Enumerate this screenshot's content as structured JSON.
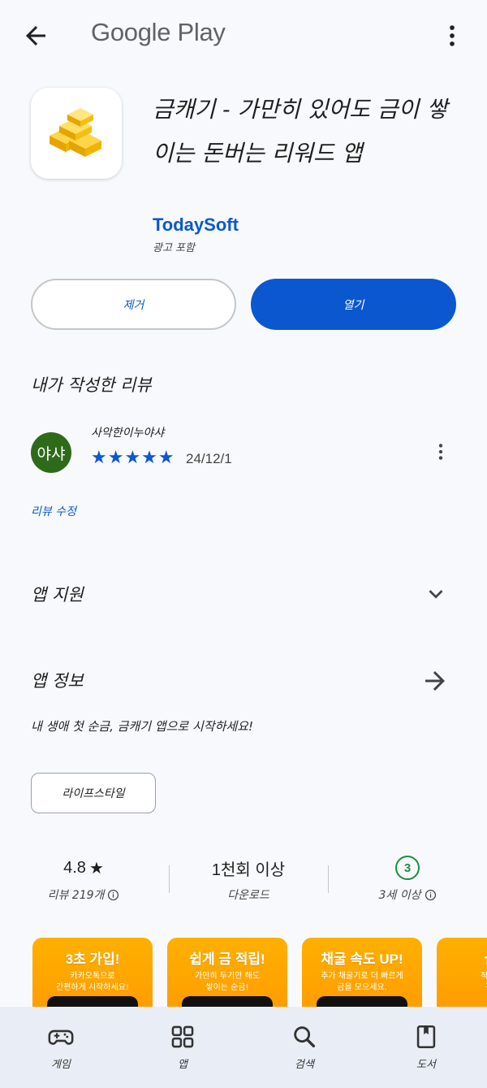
{
  "header": {
    "brand": "Google Play",
    "back_icon": "arrow-back-icon",
    "more_icon": "more-vert-icon"
  },
  "app": {
    "title": "금캐기 - 가만히 있어도 금이 쌓이는 돈버는 리워드 앱",
    "developer": "TodaySoft",
    "ads_notice": "광고 포함",
    "remove_label": "제거",
    "open_label": "열기"
  },
  "my_review": {
    "section_title": "내가 작성한 리뷰",
    "avatar_text": "야샤",
    "reviewer": "사악한이누야샤",
    "stars": "★★★★★",
    "rating": 5,
    "date": "24/12/1",
    "edit_label": "리뷰 수정"
  },
  "app_support": {
    "title": "앱 지원"
  },
  "about": {
    "title": "앱 정보",
    "description": "내 생애 첫 순금, 금캐기 앱으로 시작하세요!",
    "tag": "라이프스타일"
  },
  "stats": {
    "rating_value": "4.8",
    "rating_star": "★",
    "reviews_label": "리뷰 219개",
    "downloads_value": "1천회 이상",
    "downloads_label": "다운로드",
    "age_value": "3",
    "age_label": "3세 이상"
  },
  "screenshots": [
    {
      "title": "3초 가입!",
      "subtitle_1": "카카오톡으로",
      "subtitle_2": "간편하게 시작하세요!"
    },
    {
      "title": "쉽게 금 적립!",
      "subtitle_1": "가만히 두기만 해도",
      "subtitle_2": "쌓이는 순금!"
    },
    {
      "title": "채굴 속도 UP!",
      "subtitle_1": "추가 채굴기로 더 빠르게",
      "subtitle_2": "금을 모으세요."
    },
    {
      "title": "실물",
      "subtitle_1": "적립한 금",
      "subtitle_2": "전환할"
    }
  ],
  "bottom_nav": [
    {
      "label": "게임",
      "icon": "gamepad-icon"
    },
    {
      "label": "앱",
      "icon": "apps-grid-icon"
    },
    {
      "label": "검색",
      "icon": "search-icon"
    },
    {
      "label": "도서",
      "icon": "book-icon"
    }
  ],
  "colors": {
    "accent": "#0b57d0",
    "avatar": "#2d6a1a",
    "age_rating": "#1e8e3e"
  }
}
